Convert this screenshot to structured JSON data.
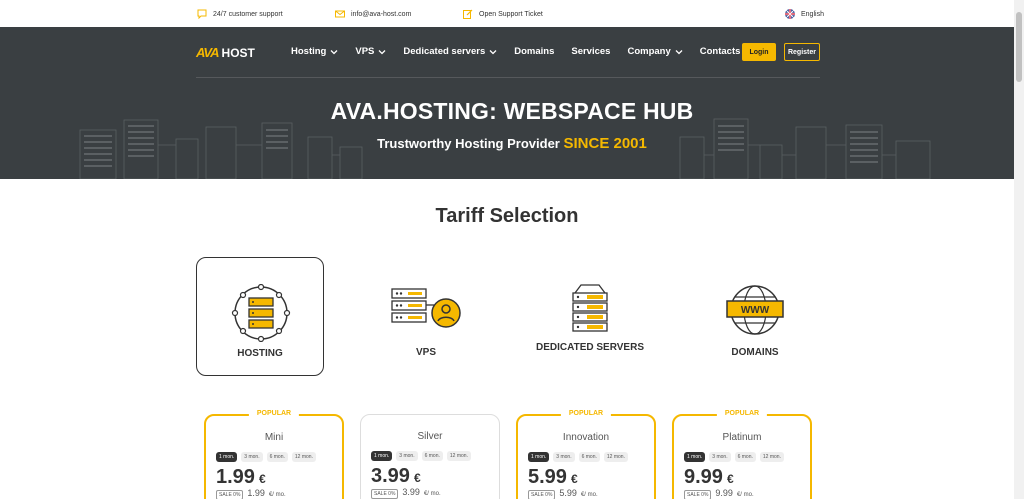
{
  "topbar": {
    "support": "24/7 customer support",
    "email": "info@ava-host.com",
    "ticket": "Open Support Ticket",
    "language": "English"
  },
  "header": {
    "logo_mark": "AVA",
    "logo_text": "HOST",
    "nav": [
      {
        "label": "Hosting",
        "has_dropdown": true
      },
      {
        "label": "VPS",
        "has_dropdown": true
      },
      {
        "label": "Dedicated servers",
        "has_dropdown": true
      },
      {
        "label": "Domains",
        "has_dropdown": false
      },
      {
        "label": "Services",
        "has_dropdown": false
      },
      {
        "label": "Company",
        "has_dropdown": true
      },
      {
        "label": "Contacts",
        "has_dropdown": false
      }
    ],
    "login_label": "Login",
    "register_label": "Register"
  },
  "hero": {
    "title": "AVA.HOSTING: WEBSPACE HUB",
    "subtitle": "Trustworthy Hosting Provider",
    "subtitle_accent": "SINCE 2001"
  },
  "tariffs": {
    "title": "Tariff Selection",
    "items": [
      {
        "label": "HOSTING",
        "icon": "hosting-icon",
        "active": true
      },
      {
        "label": "VPS",
        "icon": "vps-icon",
        "active": false
      },
      {
        "label": "DEDICATED SERVERS",
        "icon": "dedicated-servers-icon",
        "active": false
      },
      {
        "label": "DOMAINS",
        "icon": "domains-icon",
        "active": false
      }
    ]
  },
  "plans": [
    {
      "badge": "POPULAR",
      "name": "Mini",
      "price": "1.99",
      "currency": "€",
      "sale": "SALE 0%",
      "sale_price": "1.99",
      "per": "€/ mo."
    },
    {
      "badge": "",
      "name": "Silver",
      "price": "3.99",
      "currency": "€",
      "sale": "SALE 0%",
      "sale_price": "3.99",
      "per": "€/ mo."
    },
    {
      "badge": "POPULAR",
      "name": "Innovation",
      "price": "5.99",
      "currency": "€",
      "sale": "SALE 0%",
      "sale_price": "5.99",
      "per": "€/ mo."
    },
    {
      "badge": "POPULAR",
      "name": "Platinum",
      "price": "9.99",
      "currency": "€",
      "sale": "SALE 0%",
      "sale_price": "9.99",
      "per": "€/ mo."
    }
  ],
  "periods": [
    "1 mon.",
    "3 mon.",
    "6 mon.",
    "12 mon."
  ],
  "colors": {
    "accent": "#f5b800",
    "header_bg": "#3a3f42",
    "text": "#333333"
  }
}
